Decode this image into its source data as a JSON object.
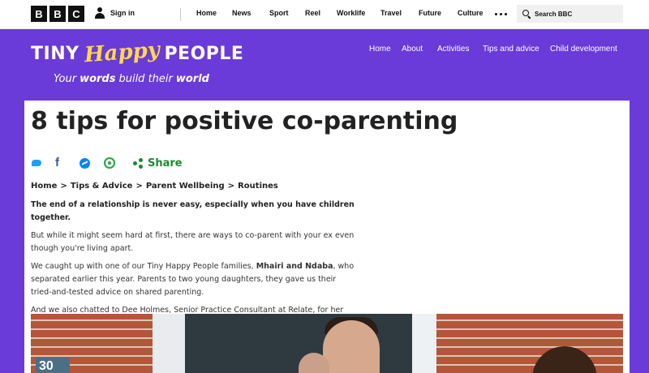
{
  "bbc_bar": {
    "logo_letters": [
      "B",
      "B",
      "C"
    ],
    "sign_in": "Sign in",
    "nav": [
      "Home",
      "News",
      "Sport",
      "Reel",
      "Worklife",
      "Travel",
      "Future",
      "Culture"
    ],
    "search_label": "Search BBC"
  },
  "site": {
    "logo_tiny": "TINY",
    "logo_happy": "Happy",
    "logo_people": "PEOPLE",
    "tagline_1": "Your",
    "tagline_2": "words",
    "tagline_3": "build their",
    "tagline_4": "world",
    "nav": [
      "Home",
      "About",
      "Activities",
      "Tips and advice",
      "Child development"
    ]
  },
  "article": {
    "title": "8 tips for positive co-parenting",
    "share_label": "Share",
    "breadcrumb": [
      "Home",
      "Tips & Advice",
      "Parent Wellbeing",
      "Routines"
    ],
    "breadcrumb_sep": ">",
    "lead": "The end of a relationship is never easy, especially when you have children together.",
    "para1": "But while it might seem hard at first, there are ways to co-parent with your ex even though you're living apart.",
    "para2_a": "We caught up with one of our Tiny Happy People families,",
    "para2_b": "Mhairi and Ndaba",
    "para2_c": ", who separated earlier this year. Parents to two young daughters, they gave us their tried-and-tested advice on shared parenting.",
    "para3": "And we also chatted to Dee Holmes, Senior Practice Consultant at Relate, for her top tips on making co-parenting as stress-free as possible.",
    "photo_house_number": "30"
  },
  "colors": {
    "brand_purple": "#6a3bd8",
    "logo_yellow": "#ffd84a",
    "share_green": "#1b8a2f"
  }
}
